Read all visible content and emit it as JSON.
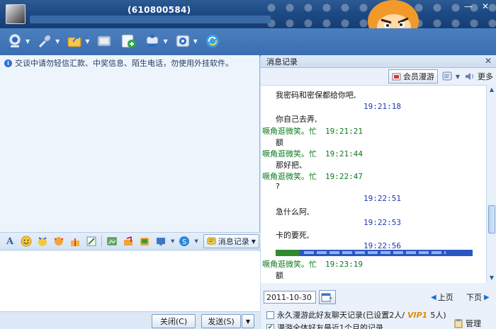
{
  "window": {
    "qq_number": "(610800584)",
    "minimize_glyph": "—",
    "close_glyph": "✕"
  },
  "toolbar": {
    "items": [
      {
        "icon": "webcam-icon"
      },
      {
        "icon": "microphone-icon"
      },
      {
        "icon": "send-file-icon"
      },
      {
        "icon": "screenshot-icon"
      },
      {
        "icon": "add-app-icon"
      },
      {
        "icon": "group-chat-icon"
      },
      {
        "icon": "settings-icon"
      },
      {
        "icon": "refresh-icon"
      }
    ]
  },
  "left": {
    "notice": "交谈中请勿轻信汇款、中奖信息、陌生电话，勿使用外挂软件。",
    "msg_record_label": "消息记录",
    "close_label": "关闭(C)",
    "send_label": "发送(S)"
  },
  "right": {
    "title": "消息记录",
    "member_roam_label": "会员漫游",
    "more_label": "更多",
    "history": [
      {
        "kind": "text",
        "text": "我密码和密保都给你吧,"
      },
      {
        "kind": "self-time",
        "text": "19:21:18"
      },
      {
        "kind": "text",
        "text": "你自己去弄,"
      },
      {
        "kind": "sender",
        "name": "噘角逛微笑。忙",
        "time": "19:21:21"
      },
      {
        "kind": "text",
        "text": "额"
      },
      {
        "kind": "sender",
        "name": "噘角逛微笑。忙",
        "time": "19:21:44"
      },
      {
        "kind": "text",
        "text": "那好把、"
      },
      {
        "kind": "sender",
        "name": "噘角逛微笑。忙",
        "time": "19:22:47"
      },
      {
        "kind": "text",
        "text": "?"
      },
      {
        "kind": "self-time",
        "text": "19:22:51"
      },
      {
        "kind": "text",
        "text": "急什么阿,"
      },
      {
        "kind": "self-time",
        "text": "19:22:53"
      },
      {
        "kind": "text",
        "text": "卡的要死,"
      },
      {
        "kind": "self-time",
        "text": "19:22:56"
      },
      {
        "kind": "image",
        "text": ""
      },
      {
        "kind": "sender",
        "name": "噘角逛微笑。忙",
        "time": "19:23:19"
      },
      {
        "kind": "text",
        "text": "额"
      }
    ],
    "date_value": "2011-10-30",
    "prev_label": "上页",
    "next_label": "下页",
    "option1": "永久漫游此好友聊天记录(已设置2人/",
    "option1_vip": "VIP1",
    "option1_tail": "5人)",
    "option2": "漫游全体好友最近1个月的记录",
    "manage_label": "管理"
  }
}
